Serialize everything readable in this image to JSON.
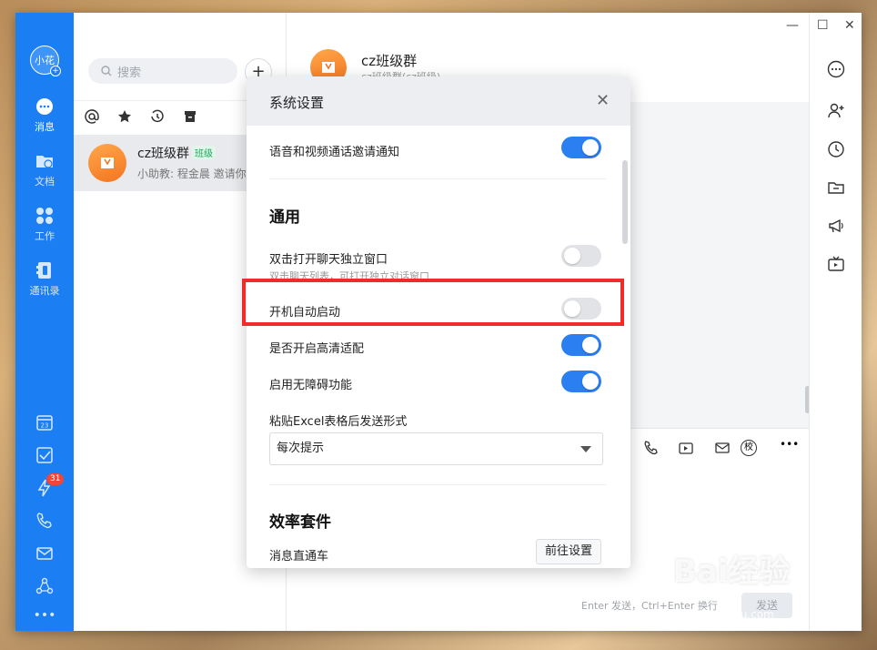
{
  "nav": {
    "avatar_text": "小花",
    "items": [
      {
        "label": "消息",
        "icon": "message-icon"
      },
      {
        "label": "文档",
        "icon": "document-icon"
      },
      {
        "label": "工作",
        "icon": "work-icon"
      },
      {
        "label": "通讯录",
        "icon": "contacts-icon"
      }
    ],
    "calendar_day": "23",
    "badge_count": "31"
  },
  "list": {
    "search_placeholder": "搜索",
    "add_label": "+",
    "chats": [
      {
        "name": "cz班级群",
        "tag": "班级",
        "preview": "小助教: 程金晨 邀请你..."
      }
    ]
  },
  "chat": {
    "title": "cz班级群",
    "subtitle": "cz班级群(cz班级)",
    "send_hint": "Enter 发送，Ctrl+Enter 换行",
    "send_label": "发送",
    "check_label": "校"
  },
  "window": {
    "minimize": "—",
    "maximize": "☐",
    "close": "✕"
  },
  "dialog": {
    "title": "系统设置",
    "close": "✕",
    "settings": {
      "voice_video_invite": {
        "label": "语音和视频通话邀请通知",
        "on": true
      },
      "general_title": "通用",
      "double_click_window": {
        "label": "双击打开聊天独立窗口",
        "sub": "双击聊天列表，可打开独立对话窗口",
        "on": false
      },
      "auto_start": {
        "label": "开机自动启动",
        "on": false
      },
      "hd_adapt": {
        "label": "是否开启高清适配",
        "on": true
      },
      "accessibility": {
        "label": "启用无障碍功能",
        "on": true
      },
      "excel_paste": {
        "label": "粘贴Excel表格后发送形式",
        "value": "每次提示"
      },
      "efficiency_title": "效率套件",
      "msg_express": {
        "label": "消息直通车",
        "button": "前往设置"
      }
    }
  },
  "watermark": {
    "text": "Bai经验",
    "sub": "jingyan.baidu.com"
  },
  "colors": {
    "nav_blue": "#1b7ef2",
    "toggle_on": "#2b7ff0",
    "highlight_red": "#ef2b2b"
  }
}
